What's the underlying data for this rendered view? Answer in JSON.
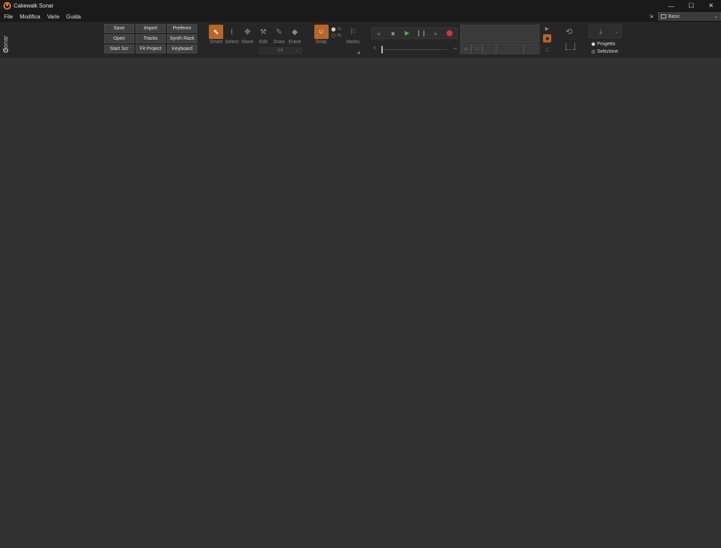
{
  "window": {
    "title": "Cakewalk Sonar",
    "minimize": "—",
    "maximize": "☐",
    "close": "✕"
  },
  "menu": {
    "items": [
      "File",
      "Modifica",
      "Varie",
      "Guida"
    ]
  },
  "workspace": {
    "label": "Basic"
  },
  "sidebar": {
    "brand": "Sonar"
  },
  "quick_buttons": [
    [
      "Save",
      "Import",
      "Preferen"
    ],
    [
      "Open",
      "Tracks",
      "Synth Rack"
    ],
    [
      "Start Scr",
      "Fit Project",
      "Keyboard"
    ]
  ],
  "tools": [
    {
      "label": "Smart",
      "icon": "cursor-icon",
      "active": true
    },
    {
      "label": "Select",
      "icon": "text-cursor-icon",
      "active": false
    },
    {
      "label": "Move",
      "icon": "move-icon",
      "active": false
    },
    {
      "label": "Edit",
      "icon": "wrench-icon",
      "active": false
    },
    {
      "label": "Draw",
      "icon": "pencil-icon",
      "active": false
    },
    {
      "label": "Erase",
      "icon": "eraser-icon",
      "active": false
    }
  ],
  "snap": {
    "label": "Snap",
    "resolution": "1/4",
    "to_label": "To",
    "by_label": "By"
  },
  "marks": {
    "label": "Marks"
  },
  "export": {
    "options": [
      {
        "label": "Progetto",
        "selected": true
      },
      {
        "label": "Selezione",
        "selected": false
      }
    ]
  },
  "colors": {
    "accent": "#b8652a",
    "play": "#4caf50",
    "record": "#c23a3a",
    "background": "#323232",
    "titlebar": "#1a1a1a"
  }
}
